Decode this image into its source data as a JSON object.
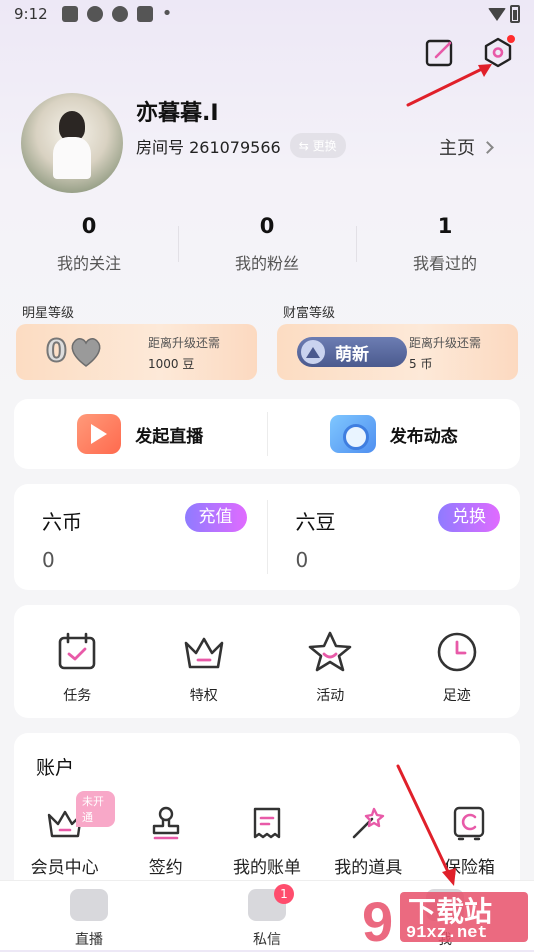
{
  "status_bar": {
    "time": "9:12",
    "more": "•"
  },
  "header": {
    "edit_icon": "edit-icon",
    "settings_icon": "settings-hexagon-icon",
    "settings_has_dot": true
  },
  "profile": {
    "username": "亦暮暮.I",
    "room_label": "房间号 261079566",
    "change_label": "⇆ 更换",
    "homepage_label": "主页"
  },
  "stats": [
    {
      "value": "0",
      "label": "我的关注"
    },
    {
      "value": "0",
      "label": "我的粉丝"
    },
    {
      "value": "1",
      "label": "我看过的"
    }
  ],
  "levels": {
    "star": {
      "title": "明星等级",
      "badge": "0",
      "hint": "距离升级还需",
      "need": "1000 豆"
    },
    "wealth": {
      "title": "财富等级",
      "badge": "萌新",
      "hint": "距离升级还需",
      "need": "5 币"
    }
  },
  "actions": [
    {
      "label": "发起直播",
      "icon": "live-play-icon"
    },
    {
      "label": "发布动态",
      "icon": "camera-icon"
    }
  ],
  "wallet": [
    {
      "title": "六币",
      "amount": "0",
      "button": "充值"
    },
    {
      "title": "六豆",
      "amount": "0",
      "button": "兑换"
    }
  ],
  "features": [
    {
      "label": "任务",
      "icon": "calendar-check-icon"
    },
    {
      "label": "特权",
      "icon": "crown-icon"
    },
    {
      "label": "活动",
      "icon": "star-icon"
    },
    {
      "label": "足迹",
      "icon": "clock-icon"
    }
  ],
  "account": {
    "title": "账户",
    "items": [
      {
        "label": "会员中心",
        "icon": "crown-icon",
        "tag": "未开通"
      },
      {
        "label": "签约",
        "icon": "stamp-icon"
      },
      {
        "label": "我的账单",
        "icon": "receipt-icon"
      },
      {
        "label": "我的道具",
        "icon": "magic-wand-icon"
      },
      {
        "label": "保险箱",
        "icon": "safe-icon"
      }
    ]
  },
  "tabbar": [
    {
      "label": "直播",
      "icon": "live-tab-icon"
    },
    {
      "label": "私信",
      "icon": "message-tab-icon",
      "count": "1"
    },
    {
      "label": "我",
      "icon": "profile-tab-icon"
    }
  ],
  "watermark": {
    "line1": "下载站",
    "line2": "91xz.net"
  },
  "colors": {
    "accent_gradient_start": "#8f7bff",
    "accent_gradient_end": "#e06bff",
    "pink": "#e85aa8",
    "red_dot": "#ff2d2d"
  }
}
